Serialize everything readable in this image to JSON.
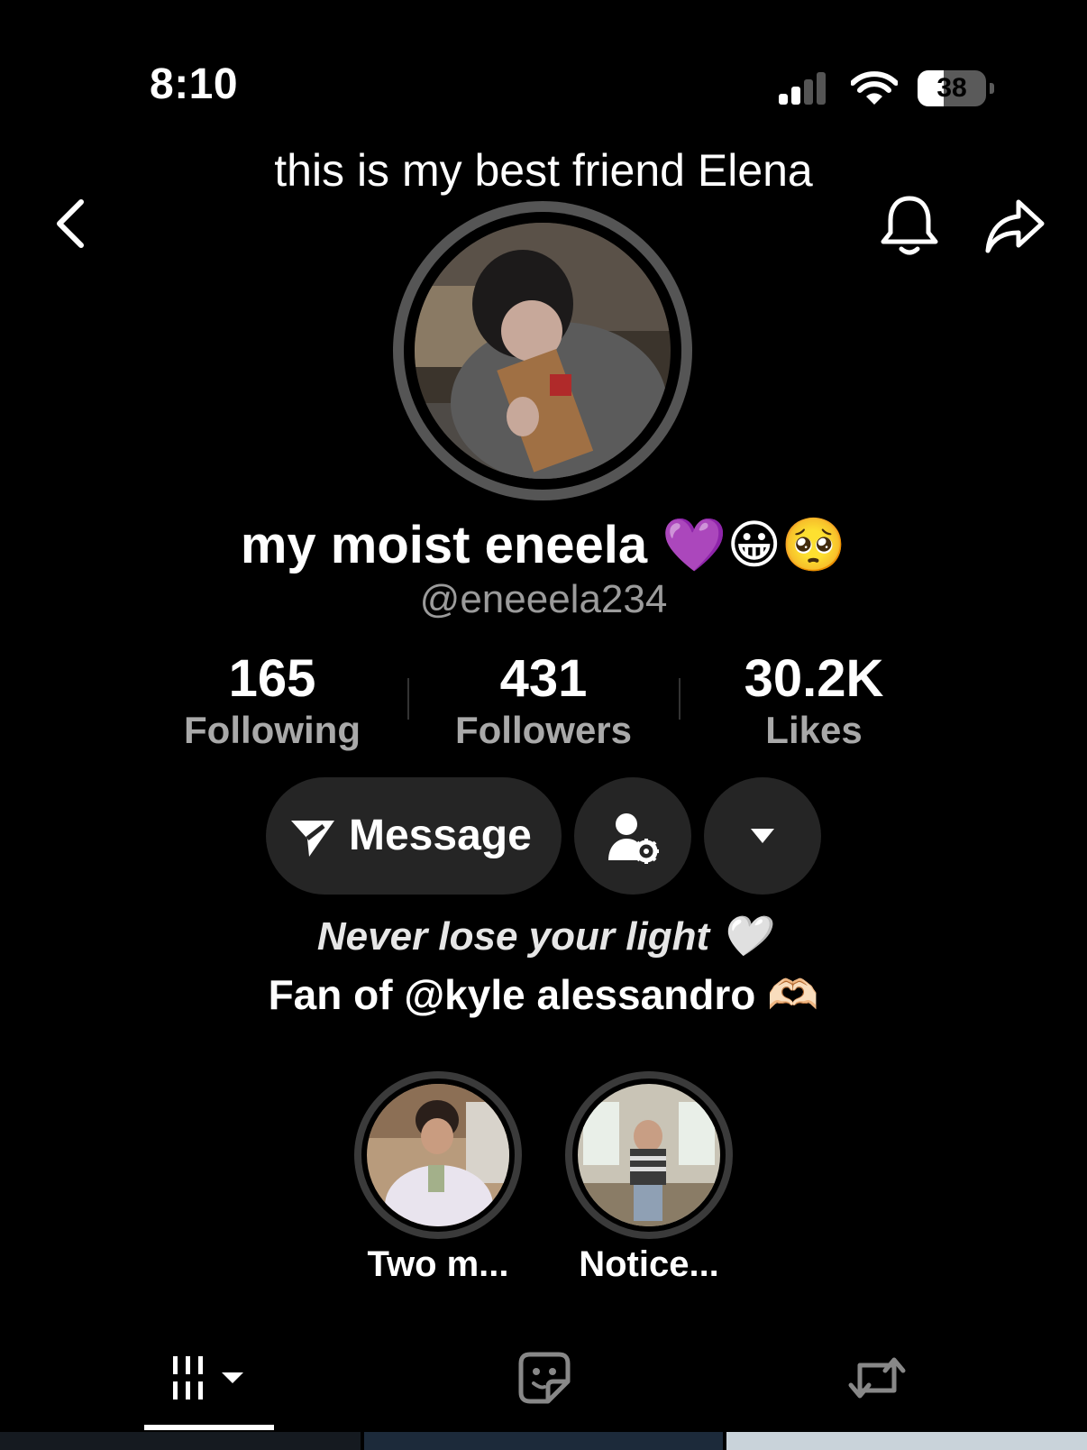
{
  "status_bar": {
    "time": "8:10",
    "battery_level": "38",
    "battery_fraction": 0.38,
    "signal_bars_active": 2,
    "signal_bars_total": 4
  },
  "caption": "this is my best friend Elena",
  "header": {
    "back_icon": "chevron-left-icon",
    "bell_icon": "bell-icon",
    "share_icon": "share-arrow-icon"
  },
  "profile": {
    "display_name": "my moist eneela 💜😀🥺",
    "username": "@eneeela234"
  },
  "stats": [
    {
      "value": "165",
      "label": "Following"
    },
    {
      "value": "431",
      "label": "Followers"
    },
    {
      "value": "30.2K",
      "label": "Likes"
    }
  ],
  "actions": {
    "message_label": "Message",
    "message_icon": "paper-plane-icon",
    "friend_icon": "person-gear-icon",
    "more_icon": "caret-down-icon"
  },
  "bio": {
    "line1": "Never lose your light 🤍",
    "line2": "Fan of @kyle alessandro 🫶🏻"
  },
  "highlights": [
    {
      "label": "Two m..."
    },
    {
      "label": "Notice..."
    }
  ],
  "tabs": {
    "videos_icon": "grid-videos-icon",
    "favorites_icon": "sticker-face-icon",
    "reposts_icon": "repost-icon"
  },
  "colors": {
    "background": "#000000",
    "button_bg": "#252525",
    "secondary_text": "#9b9b9b"
  }
}
